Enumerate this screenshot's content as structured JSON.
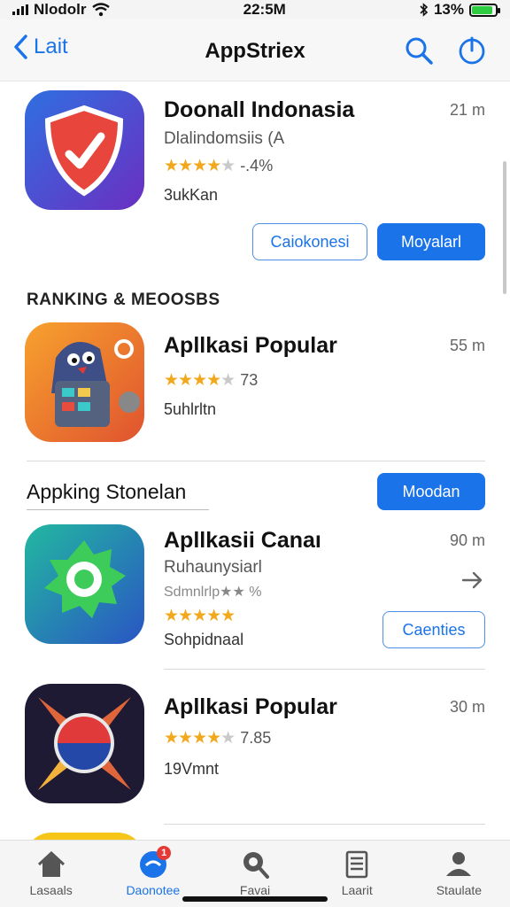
{
  "status_bar": {
    "carrier": "Nlodolr",
    "time": "22:5M",
    "battery": "13%",
    "battery_level": 0.9
  },
  "nav": {
    "back_label": "Lait",
    "title": "AppStriex",
    "search_icon": "search-icon",
    "power_icon": "power-icon"
  },
  "featured": {
    "name": "Doonall Indonasia",
    "subtitle": "Dlalindomsiis (A",
    "rating_stars": 4,
    "rating_value": "-.4%",
    "downloads": "3ukKan",
    "size": "21 m",
    "button_secondary": "Caiokonesi",
    "button_primary": "Moyalarl"
  },
  "ranking_section": {
    "header": "RANKING & MEOOSBS"
  },
  "ranking_app": {
    "name": "Apllkasi Popular",
    "rating_stars": 4,
    "rating_value": "73",
    "downloads": "5uhlrltn",
    "size": "55 m"
  },
  "appking_section": {
    "title": "Appking Stonelan",
    "button": "Moodan"
  },
  "apps": [
    {
      "name": "Apllkasii Canaı",
      "subtitle": "Ruhaunysiarl",
      "secondary_line": "Sdmnlrlp★★ %",
      "rating_stars": 5,
      "downloads": "Sohpidnaal",
      "size": "90 m",
      "button": "Caenties"
    },
    {
      "name": "Apllkasi Popular",
      "rating_stars": 4,
      "rating_value": "7.85",
      "downloads": "19Vmnt",
      "size": "30 m"
    }
  ],
  "tabs": [
    {
      "label": "Lasaals",
      "icon": "home-icon"
    },
    {
      "label": "Daonotee",
      "icon": "chat-bubble-icon",
      "badge": "1"
    },
    {
      "label": "Favai",
      "icon": "search-icon"
    },
    {
      "label": "Laarit",
      "icon": "clipboard-icon"
    },
    {
      "label": "Staulate",
      "icon": "person-icon"
    }
  ],
  "colors": {
    "accent": "#1a73e8",
    "star": "#f2a81d"
  }
}
